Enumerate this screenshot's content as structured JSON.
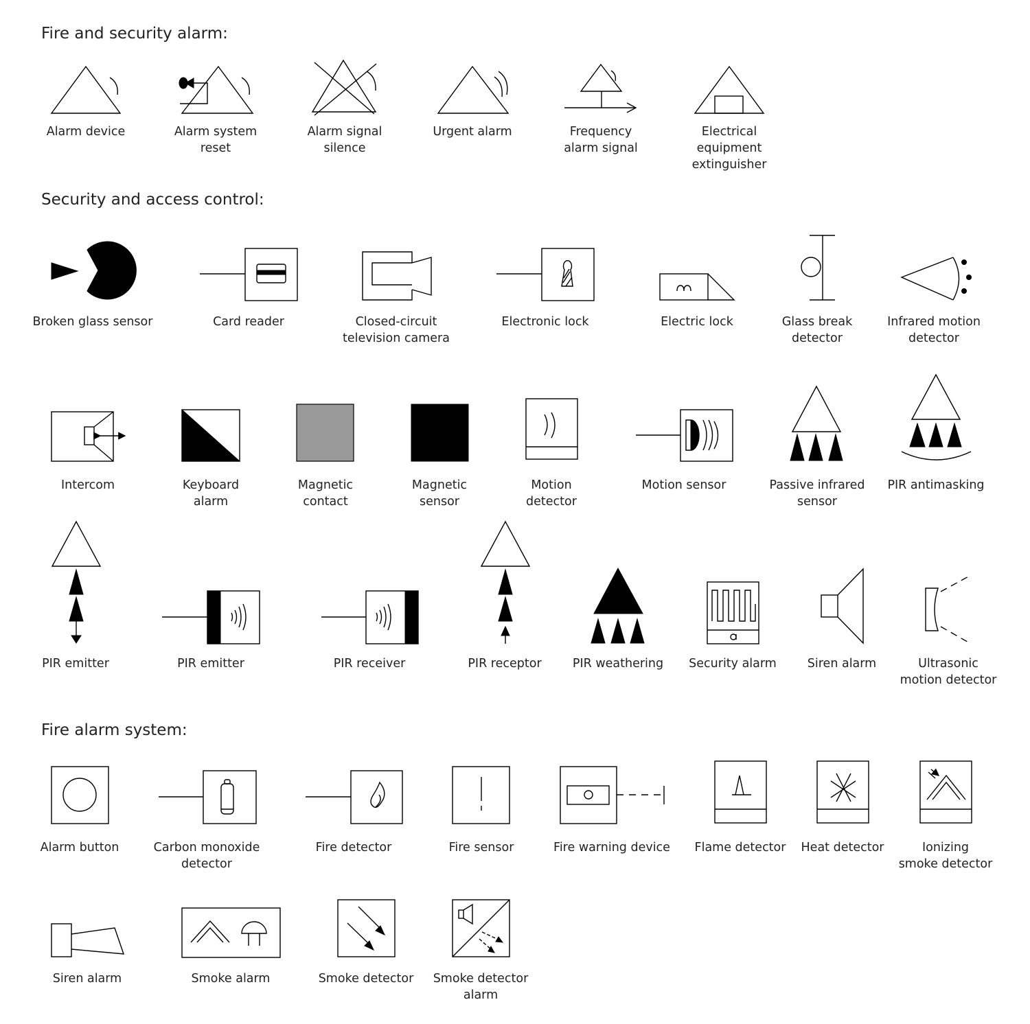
{
  "sections": [
    {
      "heading": "Fire and security alarm:",
      "items": [
        {
          "label": "Alarm device"
        },
        {
          "label": "Alarm system\nreset"
        },
        {
          "label": "Alarm signal\nsilence"
        },
        {
          "label": "Urgent alarm"
        },
        {
          "label": "Frequency\nalarm signal"
        },
        {
          "label": "Electrical\nequipment\nextinguisher"
        }
      ]
    },
    {
      "heading": "Security and access control:",
      "items": [
        {
          "label": "Broken glass sensor"
        },
        {
          "label": "Card reader"
        },
        {
          "label": "Closed-circuit\ntelevision camera"
        },
        {
          "label": "Electronic lock"
        },
        {
          "label": "Electric lock"
        },
        {
          "label": "Glass break\ndetector"
        },
        {
          "label": "Infrared motion\ndetector"
        },
        {
          "label": "Intercom"
        },
        {
          "label": "Keyboard\nalarm"
        },
        {
          "label": "Magnetic\ncontact"
        },
        {
          "label": "Magnetic\nsensor"
        },
        {
          "label": "Motion\ndetector"
        },
        {
          "label": "Motion sensor"
        },
        {
          "label": "Passive infrared\nsensor"
        },
        {
          "label": "PIR antimasking"
        },
        {
          "label": "PIR emitter"
        },
        {
          "label": "PIR emitter"
        },
        {
          "label": "PIR receiver"
        },
        {
          "label": "PIR receptor"
        },
        {
          "label": "PIR weathering"
        },
        {
          "label": "Security alarm"
        },
        {
          "label": "Siren alarm"
        },
        {
          "label": "Ultrasonic\nmotion detector"
        }
      ]
    },
    {
      "heading": "Fire alarm system:",
      "items": [
        {
          "label": "Alarm button"
        },
        {
          "label": "Carbon monoxide\ndetector"
        },
        {
          "label": "Fire detector"
        },
        {
          "label": "Fire sensor"
        },
        {
          "label": "Fire warning device"
        },
        {
          "label": "Flame detector"
        },
        {
          "label": "Heat detector"
        },
        {
          "label": "Ionizing\nsmoke detector"
        },
        {
          "label": "Siren alarm"
        },
        {
          "label": "Smoke alarm"
        },
        {
          "label": "Smoke detector"
        },
        {
          "label": "Smoke detector\nalarm"
        }
      ]
    }
  ],
  "colors": {
    "stroke": "#000000",
    "magnetic_contact_fill": "#999999",
    "text": "#222222"
  }
}
